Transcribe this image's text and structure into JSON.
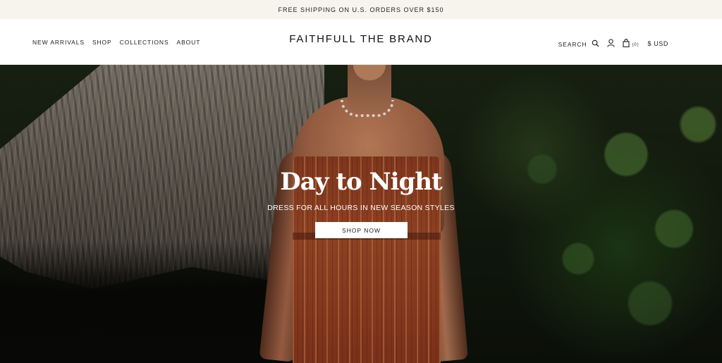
{
  "announcement": {
    "text": "FREE SHIPPING ON U.S. ORDERS OVER $150"
  },
  "header": {
    "nav_left": [
      {
        "label": "NEW ARRIVALS"
      },
      {
        "label": "SHOP"
      },
      {
        "label": "COLLECTIONS"
      },
      {
        "label": "ABOUT"
      }
    ],
    "logo": "FAITHFULL THE BRAND",
    "search_label": "SEARCH",
    "cart_count": "(0)",
    "currency": "$ USD",
    "icons": [
      "search-icon",
      "account-icon",
      "cart-icon"
    ]
  },
  "hero": {
    "title": "Day to Night",
    "subtitle": "DRESS FOR ALL HOURS IN NEW SEASON STYLES",
    "cta_label": "SHOP NOW"
  },
  "colors": {
    "announcement_bg": "#f7f4ee",
    "text": "#1d1d1d",
    "hero_text": "#ffffff",
    "button_bg": "#ffffff"
  }
}
